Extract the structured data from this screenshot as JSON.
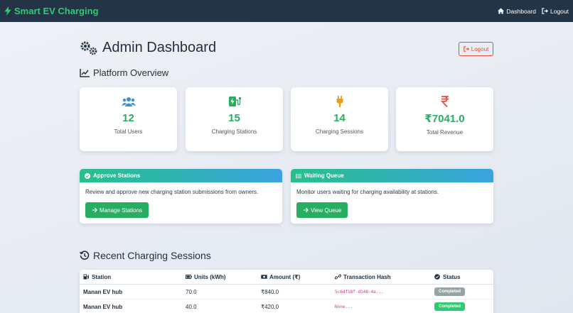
{
  "navbar": {
    "brand": "Smart EV Charging",
    "links": [
      {
        "label": "Dashboard"
      },
      {
        "label": "Logout"
      }
    ]
  },
  "header": {
    "title": "Admin Dashboard",
    "logout_label": "Logout"
  },
  "overview": {
    "title": "Platform Overview",
    "stats": [
      {
        "value": "12",
        "label": "Total Users",
        "icon": "users-icon",
        "color": "#3a8fd6"
      },
      {
        "value": "15",
        "label": "Charging Stations",
        "icon": "charging-station-icon",
        "color": "#27ae60"
      },
      {
        "value": "14",
        "label": "Charging Sessions",
        "icon": "plug-icon",
        "color": "#f39c12"
      },
      {
        "value": "₹7041.0",
        "label": "Total Revenue",
        "icon": "rupee-icon",
        "color": "#e74c3c"
      }
    ]
  },
  "actions": [
    {
      "title": "Approve Stations",
      "description": "Review and approve new charging station submissions from owners.",
      "button": "Manage Stations"
    },
    {
      "title": "Waiting Queue",
      "description": "Monitor users waiting for charging availability at stations.",
      "button": "View Queue"
    }
  ],
  "recent": {
    "title": "Recent Charging Sessions",
    "columns": [
      "Station",
      "Units (kWh)",
      "Amount (₹)",
      "Transaction Hash",
      "Status"
    ],
    "rows": [
      {
        "station": "Manan EV hub",
        "units": "70.0",
        "amount": "₹840.0",
        "hash": "5c6df18f-d148-4a...",
        "status": "Completed",
        "status_color": "#95a5a6"
      },
      {
        "station": "Manan EV hub",
        "units": "40.0",
        "amount": "₹420.0",
        "hash": "None...",
        "status": "Completed",
        "status_color": "#2ecc71"
      }
    ]
  },
  "colors": {
    "navbar": "#243447",
    "brand": "#2ecc71",
    "accent_green": "#27ae60",
    "danger": "#e74c3c"
  }
}
